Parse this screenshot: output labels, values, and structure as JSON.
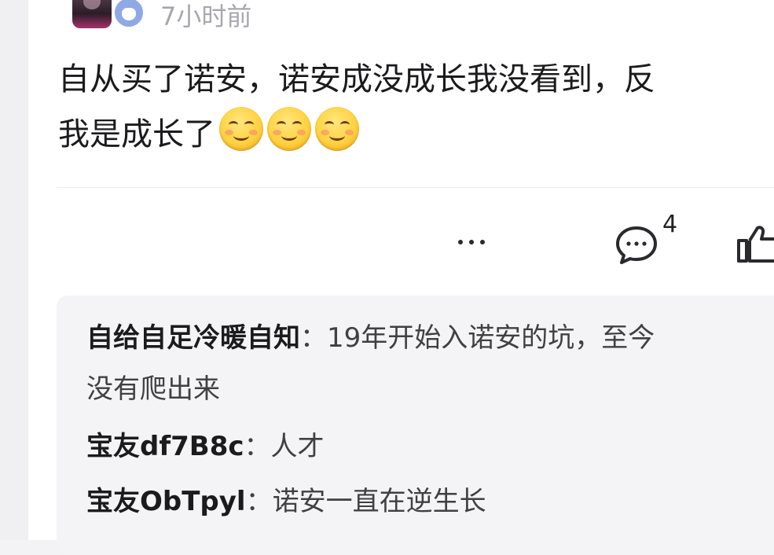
{
  "header": {
    "timestamp": "7小时前"
  },
  "post": {
    "line1": "自从买了诺安，诺安成没成长我没看到，反",
    "line2": "我是成长了"
  },
  "actions": {
    "comment_count": "4"
  },
  "replies": [
    {
      "author": "自给自足冷暖自知",
      "separator": "：",
      "text": "19年开始入诺安的坑，至今",
      "continuation": "没有爬出来"
    },
    {
      "author": "宝友df7B8c",
      "separator": "：",
      "text": "人才"
    },
    {
      "author": "宝友ObTpyl",
      "separator": "：",
      "text": "诺安一直在逆生长"
    }
  ],
  "colors": {
    "text_primary": "#1b1b1d",
    "text_secondary": "#a7a7ad",
    "reply_bg": "#f4f4f6"
  },
  "icons": [
    "avatar",
    "fan-badge-icon",
    "smiling-emoji",
    "more-icon",
    "comment-icon",
    "like-icon"
  ]
}
